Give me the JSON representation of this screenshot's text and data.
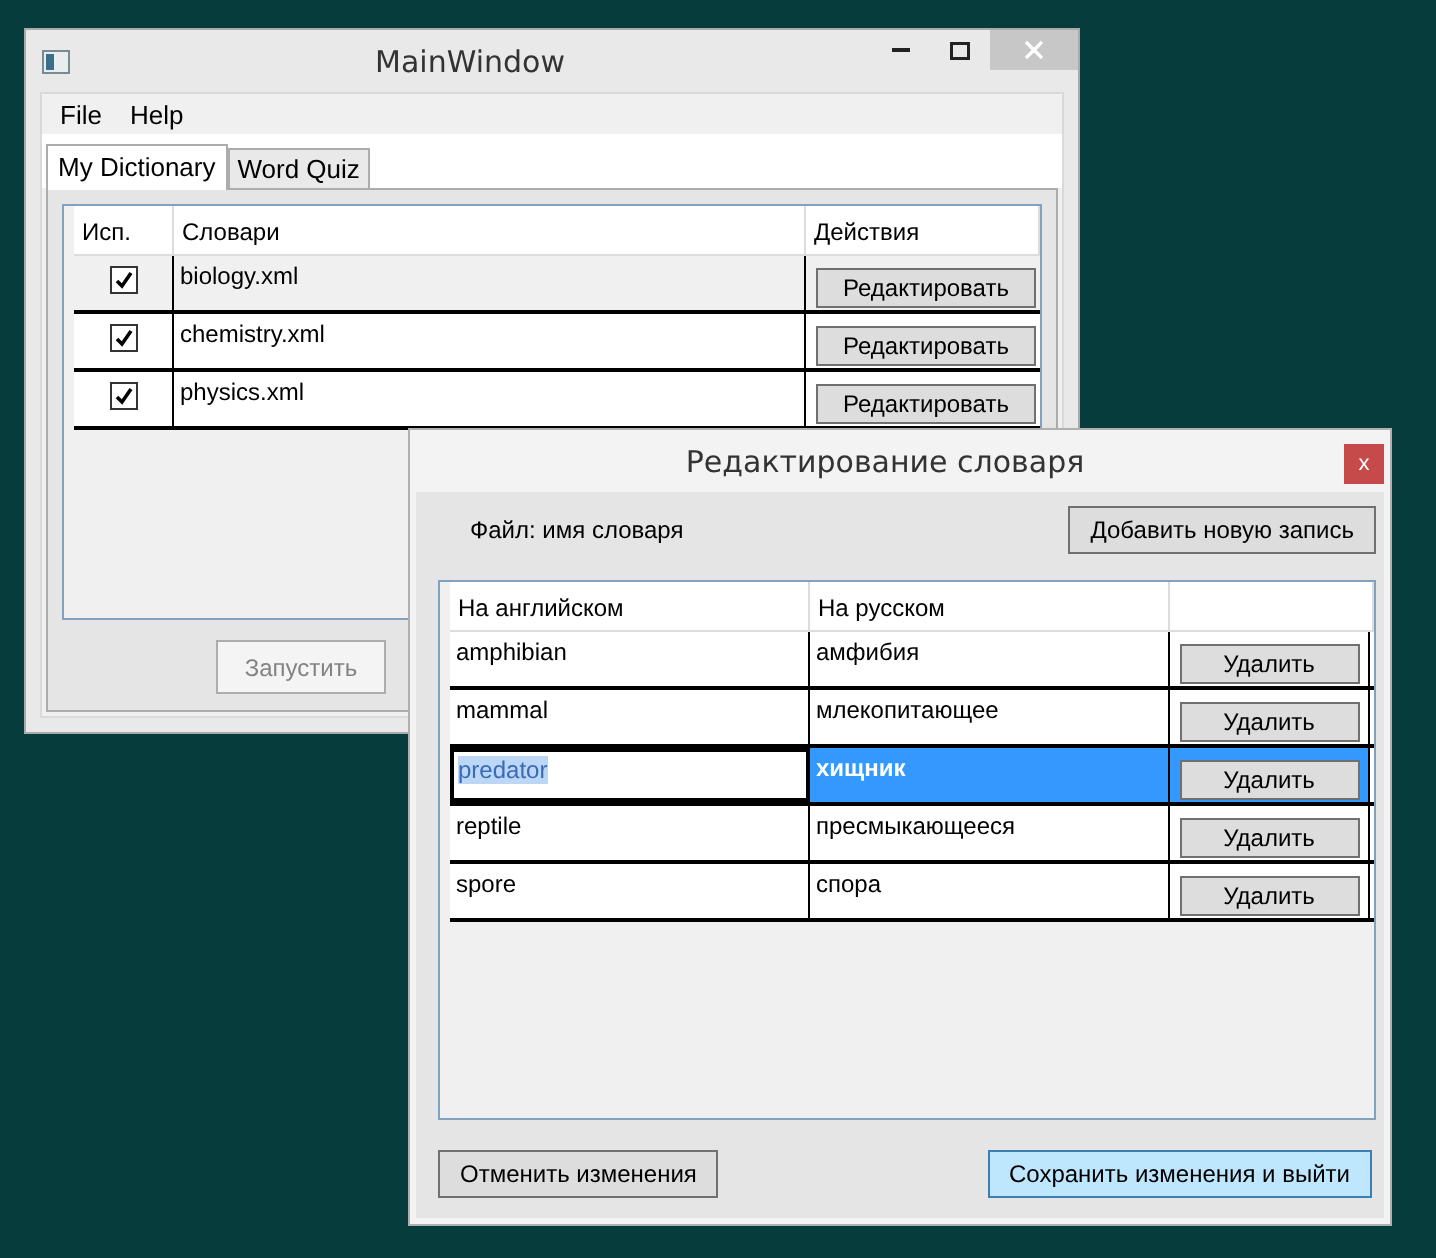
{
  "main_window": {
    "title": "MainWindow",
    "menu": [
      "File",
      "Help"
    ],
    "tabs": [
      {
        "label": "My Dictionary",
        "selected": true
      },
      {
        "label": "Word Quiz",
        "selected": false
      }
    ],
    "table": {
      "columns": [
        "Исп.",
        "Словари",
        "Действия"
      ],
      "rows": [
        {
          "checked": true,
          "name": "biology.xml",
          "action": "Редактировать"
        },
        {
          "checked": true,
          "name": "chemistry.xml",
          "action": "Редактировать"
        },
        {
          "checked": true,
          "name": "physics.xml",
          "action": "Редактировать"
        }
      ]
    },
    "run_button": {
      "label": "Запустить",
      "disabled": true
    }
  },
  "dialog": {
    "title": "Редактирование словаря",
    "close": "x",
    "file_label": "Файл: имя словаря",
    "add_button": "Добавить новую запись",
    "table": {
      "columns": [
        "На английском",
        "На русском"
      ],
      "rows": [
        {
          "english": "amphibian",
          "russian": "амфибия",
          "action": "Удалить",
          "selected": false
        },
        {
          "english": "mammal",
          "russian": "млекопитающее",
          "action": "Удалить",
          "selected": false
        },
        {
          "english": "predator",
          "russian": "хищник",
          "action": "Удалить",
          "selected": true
        },
        {
          "english": "reptile",
          "russian": "пресмыкающееся",
          "action": "Удалить",
          "selected": false
        },
        {
          "english": "spore",
          "russian": "спора",
          "action": "Удалить",
          "selected": false
        }
      ]
    },
    "cancel_button": {
      "label": "Отменить изменения",
      "default": false
    },
    "save_button": {
      "label": "Сохранить изменения и выйти",
      "default": true
    }
  }
}
